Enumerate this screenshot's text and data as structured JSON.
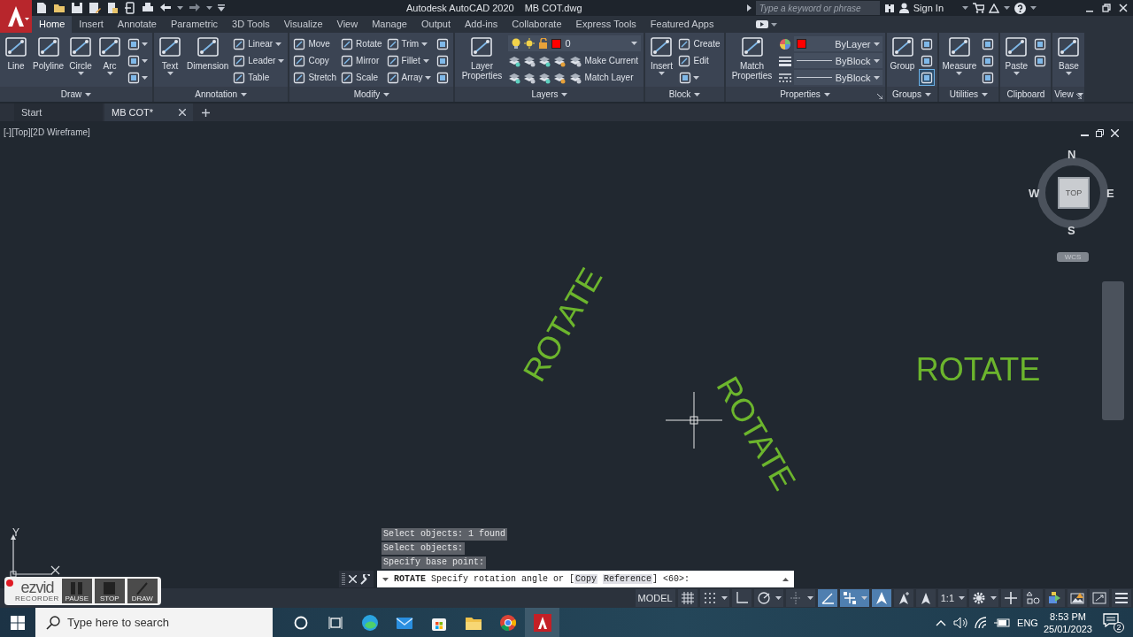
{
  "title_bar": {
    "app_title": "Autodesk AutoCAD 2020",
    "file_name": "MB COT.dwg",
    "search": {
      "placeholder": "Type a keyword or phrase"
    },
    "sign_in": "Sign In"
  },
  "ribbon_tabs": [
    {
      "label": "Home",
      "selected": true
    },
    {
      "label": "Insert",
      "selected": false
    },
    {
      "label": "Annotate",
      "selected": false
    },
    {
      "label": "Parametric",
      "selected": false
    },
    {
      "label": "3D Tools",
      "selected": false
    },
    {
      "label": "Visualize",
      "selected": false
    },
    {
      "label": "View",
      "selected": false
    },
    {
      "label": "Manage",
      "selected": false
    },
    {
      "label": "Output",
      "selected": false
    },
    {
      "label": "Add-ins",
      "selected": false
    },
    {
      "label": "Collaborate",
      "selected": false
    },
    {
      "label": "Express Tools",
      "selected": false
    },
    {
      "label": "Featured Apps",
      "selected": false
    }
  ],
  "ribbon_panels": [
    {
      "title": "Draw",
      "dropdown": true,
      "launcher": false,
      "columns": [
        [
          {
            "kind": "large",
            "label": "Line",
            "dropdown": false
          }
        ],
        [
          {
            "kind": "large",
            "label": "Polyline",
            "dropdown": false
          }
        ],
        [
          {
            "kind": "large",
            "label": "Circle",
            "dropdown": true
          }
        ],
        [
          {
            "kind": "large",
            "label": "Arc",
            "dropdown": true
          }
        ],
        [
          {
            "kind": "icon",
            "dropdown": true,
            "selected": false
          },
          {
            "kind": "icon",
            "dropdown": true,
            "selected": false
          },
          {
            "kind": "icon",
            "dropdown": true,
            "selected": false
          }
        ]
      ]
    },
    {
      "title": "Annotation",
      "dropdown": true,
      "launcher": false,
      "columns": [
        [
          {
            "kind": "large",
            "label": "Text",
            "dropdown": true
          }
        ],
        [
          {
            "kind": "large",
            "label": "Dimension",
            "dropdown": false
          }
        ],
        [
          {
            "kind": "small",
            "label": "Linear",
            "dropdown": true
          },
          {
            "kind": "small",
            "label": "Leader",
            "dropdown": true
          },
          {
            "kind": "small",
            "label": "Table",
            "dropdown": false
          }
        ]
      ]
    },
    {
      "title": "Modify",
      "dropdown": true,
      "launcher": false,
      "columns": [
        [
          {
            "kind": "small",
            "label": "Move",
            "dropdown": false
          },
          {
            "kind": "small",
            "label": "Copy",
            "dropdown": false
          },
          {
            "kind": "small",
            "label": "Stretch",
            "dropdown": false
          }
        ],
        [
          {
            "kind": "small",
            "label": "Rotate",
            "dropdown": false
          },
          {
            "kind": "small",
            "label": "Mirror",
            "dropdown": false
          },
          {
            "kind": "small",
            "label": "Scale",
            "dropdown": false
          }
        ],
        [
          {
            "kind": "small",
            "label": "Trim",
            "dropdown": true
          },
          {
            "kind": "small",
            "label": "Fillet",
            "dropdown": true
          },
          {
            "kind": "small",
            "label": "Array",
            "dropdown": true
          }
        ],
        [
          {
            "kind": "icon",
            "dropdown": false,
            "selected": false
          },
          {
            "kind": "icon",
            "dropdown": false,
            "selected": false
          },
          {
            "kind": "icon",
            "dropdown": false,
            "selected": false
          }
        ]
      ]
    },
    {
      "title": "Layers",
      "dropdown": true,
      "launcher": false,
      "columns": [
        [
          {
            "kind": "large",
            "label": "Layer Properties",
            "dropdown": false
          }
        ],
        [
          {
            "kind": "layer-combo",
            "value": "0",
            "color": "#ff0000"
          },
          {
            "kind": "icon-group",
            "label": "Make Current"
          },
          {
            "kind": "icon-group",
            "label": "Match Layer"
          }
        ]
      ]
    },
    {
      "title": "Block",
      "dropdown": true,
      "launcher": false,
      "columns": [
        [
          {
            "kind": "large",
            "label": "Insert",
            "dropdown": true
          }
        ],
        [
          {
            "kind": "small",
            "label": "Create",
            "dropdown": false
          },
          {
            "kind": "small",
            "label": "Edit",
            "dropdown": false
          },
          {
            "kind": "icon",
            "dropdown": true,
            "selected": false
          }
        ]
      ]
    },
    {
      "title": "Properties",
      "dropdown": true,
      "launcher": true,
      "columns": [
        [
          {
            "kind": "large",
            "label": "Match Properties",
            "dropdown": false
          }
        ],
        [
          {
            "kind": "prop-combo",
            "value": "ByLayer",
            "color": "#ff0000"
          },
          {
            "kind": "prop-combo",
            "value": "ByBlock"
          },
          {
            "kind": "prop-combo",
            "value": "ByBlock"
          }
        ]
      ]
    },
    {
      "title": "Groups",
      "dropdown": true,
      "launcher": false,
      "columns": [
        [
          {
            "kind": "large",
            "label": "Group",
            "dropdown": false
          }
        ],
        [
          {
            "kind": "icon",
            "dropdown": false,
            "selected": false
          },
          {
            "kind": "icon",
            "dropdown": false,
            "selected": false
          },
          {
            "kind": "icon",
            "dropdown": false,
            "selected": true
          }
        ]
      ]
    },
    {
      "title": "Utilities",
      "dropdown": true,
      "launcher": false,
      "columns": [
        [
          {
            "kind": "large",
            "label": "Measure",
            "dropdown": true
          }
        ],
        [
          {
            "kind": "icon",
            "dropdown": false,
            "selected": false
          },
          {
            "kind": "icon",
            "dropdown": false,
            "selected": false
          },
          {
            "kind": "icon",
            "dropdown": false,
            "selected": false
          }
        ]
      ]
    },
    {
      "title": "Clipboard",
      "dropdown": false,
      "launcher": false,
      "columns": [
        [
          {
            "kind": "large",
            "label": "Paste",
            "dropdown": true
          }
        ],
        [
          {
            "kind": "icon",
            "dropdown": false,
            "selected": false
          },
          {
            "kind": "icon",
            "dropdown": false,
            "selected": false
          }
        ]
      ]
    },
    {
      "title": "View",
      "dropdown": true,
      "launcher": true,
      "columns": [
        [
          {
            "kind": "large",
            "label": "Base",
            "dropdown": true
          }
        ]
      ]
    }
  ],
  "document_tabs": [
    {
      "label": "Start",
      "selected": false
    },
    {
      "label": "MB COT*",
      "selected": true
    }
  ],
  "viewport": {
    "label": "[-][Top][2D Wireframe]"
  },
  "view_cube": {
    "north": "N",
    "south": "S",
    "east": "E",
    "west": "W",
    "face": "TOP",
    "coordinate_system": "WCS"
  },
  "canvas_texts": [
    {
      "text": "ROTATE",
      "kind": "rotated-left"
    },
    {
      "text": "ROTATE",
      "kind": "rotated-right"
    },
    {
      "text": "ROTATE",
      "kind": "upright"
    }
  ],
  "ucs_axis": {
    "y_label": "Y"
  },
  "command_history": [
    "Select objects: 1 found",
    "Select objects:",
    "Specify base point:"
  ],
  "command_line": {
    "command": "ROTATE",
    "prompt": "Specify rotation angle or [",
    "options": [
      "Copy",
      "Reference"
    ],
    "suffix": "] <60>:"
  },
  "status_bar": [
    {
      "kind": "text",
      "label": "MODEL",
      "on": false,
      "dropdown": false
    },
    {
      "kind": "icon",
      "on": false,
      "dropdown": false
    },
    {
      "kind": "icon",
      "on": false,
      "dropdown": true
    },
    {
      "kind": "icon",
      "on": false,
      "dropdown": false
    },
    {
      "kind": "icon",
      "on": false,
      "dropdown": true
    },
    {
      "kind": "icon",
      "on": false,
      "dropdown": true
    },
    {
      "kind": "icon",
      "on": true,
      "dropdown": false
    },
    {
      "kind": "icon",
      "on": true,
      "dropdown": true
    },
    {
      "kind": "icon",
      "on": true,
      "dropdown": false
    },
    {
      "kind": "icon",
      "on": false,
      "dropdown": false
    },
    {
      "kind": "icon",
      "on": false,
      "dropdown": false
    },
    {
      "kind": "text",
      "label": "1:1",
      "on": false,
      "dropdown": true
    },
    {
      "kind": "icon",
      "on": false,
      "dropdown": true
    },
    {
      "kind": "icon",
      "on": false,
      "dropdown": false
    },
    {
      "kind": "icon",
      "on": false,
      "dropdown": false
    },
    {
      "kind": "icon",
      "on": false,
      "dropdown": false
    },
    {
      "kind": "icon",
      "on": false,
      "dropdown": false
    },
    {
      "kind": "icon",
      "on": false,
      "dropdown": false
    },
    {
      "kind": "icon",
      "on": false,
      "dropdown": false
    }
  ],
  "recorder": {
    "brand": "ezvid",
    "subtitle": "RECORDER",
    "buttons": [
      "PAUSE",
      "STOP",
      "DRAW"
    ]
  },
  "taskbar": {
    "search": {
      "placeholder": "Type here to search"
    },
    "apps": [
      {
        "selected": false
      },
      {
        "selected": false
      },
      {
        "selected": false
      },
      {
        "selected": false
      },
      {
        "selected": false
      },
      {
        "selected": true
      }
    ],
    "language": "ENG",
    "time": "8:53 PM",
    "date": "25/01/2023",
    "notifications": "2"
  }
}
